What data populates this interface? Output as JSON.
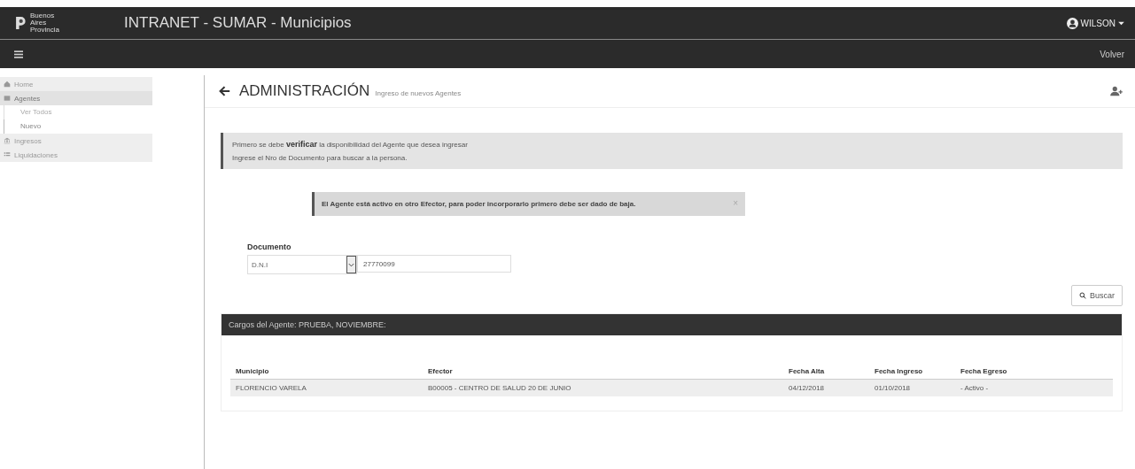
{
  "header": {
    "logo_lines": [
      "Buenos",
      "Aires",
      "Provincia"
    ],
    "title": "INTRANET - SUMAR - Municipios",
    "user": "WILSON",
    "back": "Volver"
  },
  "sidebar": {
    "items": [
      {
        "label": "Home",
        "selected": false
      },
      {
        "label": "Agentes",
        "selected": true,
        "children": [
          {
            "label": "Ver Todos",
            "selected": false
          },
          {
            "label": "Nuevo",
            "selected": true
          }
        ]
      },
      {
        "label": "Ingresos",
        "selected": false
      },
      {
        "label": "Liquidaciones",
        "selected": false
      }
    ]
  },
  "page": {
    "title": "ADMINISTRACIÓN",
    "subtitle": "Ingreso de nuevos Agentes"
  },
  "info": {
    "lines": [
      "Primero se debe **verificar** la disponibilidad del Agente que desea ingresar",
      "Ingrese el Nro de Documento para buscar a la persona."
    ]
  },
  "alert": {
    "text": "El Agente está activo en otro Efector, para poder incorporarlo primero debe ser dado de baja.",
    "close": "×"
  },
  "form": {
    "label": "Documento",
    "doc_type": "D.N.I",
    "doc_number": "27770099",
    "search": "Buscar"
  },
  "table": {
    "title": "Cargos del Agente: PRUEBA, NOVIEMBRE:",
    "columns": [
      "Municipio",
      "Efector",
      "Fecha Alta",
      "Fecha Ingreso",
      "Fecha Egreso"
    ],
    "rows": [
      [
        "FLORENCIO VARELA",
        "B00005 - CENTRO DE SALUD 20 DE JUNIO",
        "04/12/2018",
        "01/10/2018",
        "- Activo -"
      ]
    ]
  }
}
